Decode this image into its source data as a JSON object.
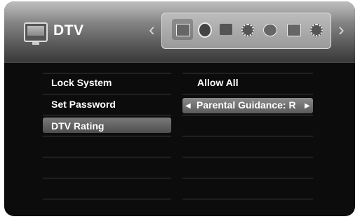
{
  "header": {
    "title": "DTV",
    "title_icon": "tv-icon",
    "nav_left_icon": "chevron-left-icon",
    "nav_right_icon": "chevron-right-icon",
    "category_icons": [
      "tv-icon",
      "disc-icon",
      "monitor-icon",
      "settings-gear-icon",
      "globe-icon",
      "mail-icon",
      "gear-icon"
    ]
  },
  "menu": {
    "items": [
      "Lock System",
      "Set Password",
      "DTV Rating"
    ],
    "selected_index": 2
  },
  "values": {
    "lock_system": "Allow All",
    "rating_left_arrow": "◀",
    "rating_value": "Parental Guidance:  R",
    "rating_right_arrow": "▶"
  }
}
